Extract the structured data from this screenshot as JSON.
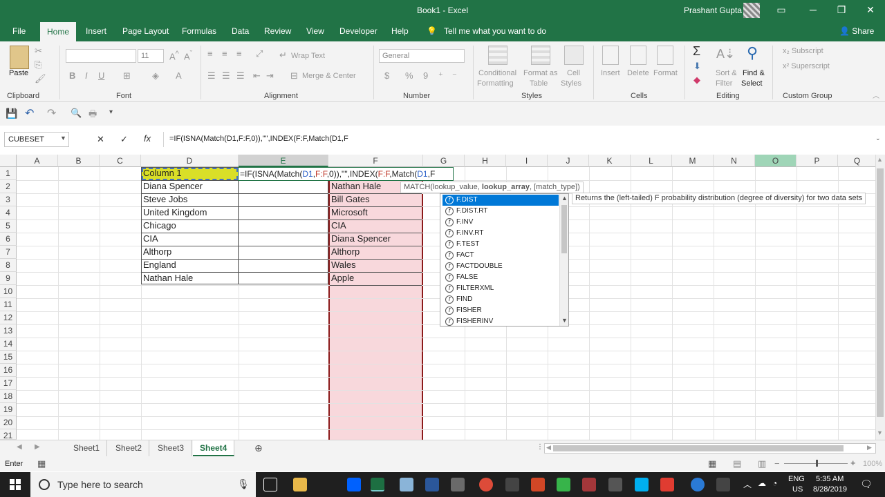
{
  "window": {
    "title": "Book1  -  Excel",
    "user": "Prashant Gupta"
  },
  "tabs": [
    "File",
    "Home",
    "Insert",
    "Page Layout",
    "Formulas",
    "Data",
    "Review",
    "View",
    "Developer",
    "Help"
  ],
  "tell_me": "Tell me what you want to do",
  "share": "Share",
  "ribbon": {
    "clipboard": {
      "label": "Clipboard",
      "paste": "Paste"
    },
    "font": {
      "label": "Font",
      "size": "11"
    },
    "alignment": {
      "label": "Alignment",
      "wrap": "Wrap Text",
      "merge": "Merge & Center"
    },
    "number": {
      "label": "Number",
      "format": "General"
    },
    "styles": {
      "label": "Styles",
      "cond1": "Conditional",
      "cond2": "Formatting",
      "fmt1": "Format as",
      "fmt2": "Table",
      "cell1": "Cell",
      "cell2": "Styles"
    },
    "cells": {
      "label": "Cells",
      "insert": "Insert",
      "delete": "Delete",
      "format": "Format"
    },
    "editing": {
      "label": "Editing",
      "sort1": "Sort &",
      "sort2": "Filter",
      "find1": "Find &",
      "find2": "Select"
    },
    "custom": {
      "label": "Custom Group",
      "subscript": "Subscript",
      "superscript": "Superscript"
    }
  },
  "namebox": "CUBESET",
  "formula": "=IF(ISNA(Match(D1,F:F,0)),\"\",INDEX(F:F,Match(D1,F",
  "columns": [
    "A",
    "B",
    "C",
    "D",
    "E",
    "F",
    "G",
    "H",
    "I",
    "J",
    "K",
    "L",
    "M",
    "N",
    "O",
    "P",
    "Q"
  ],
  "rows": [
    "1",
    "2",
    "3",
    "4",
    "5",
    "6",
    "7",
    "8",
    "9",
    "10",
    "11",
    "12",
    "13",
    "14",
    "15",
    "16",
    "17",
    "18",
    "19",
    "20",
    "21"
  ],
  "colD": [
    "Column 1",
    "Diana Spencer",
    "Steve Jobs",
    "United Kingdom",
    "Chicago",
    "CIA",
    "Althorp",
    "England",
    "Nathan Hale"
  ],
  "colF": [
    "Nathan Hale",
    "Bill Gates",
    "Microsoft",
    "CIA",
    "Diana Spencer",
    "Althorp",
    "Wales",
    "Apple"
  ],
  "e1_formula": {
    "p1": "=IF(ISNA(Match(",
    "p2": "D1",
    "p3": ",",
    "p4": "F:F",
    "p5": ",0)),\"\",INDEX(",
    "p6": "F:F",
    "p7": ",Match(",
    "p8": "D1",
    "p9": ",F"
  },
  "match_tip": {
    "a": "MATCH(lookup_value, ",
    "b": "lookup_array",
    "c": ", [match_type])"
  },
  "autocomplete": [
    "F.DIST",
    "F.DIST.RT",
    "F.INV",
    "F.INV.RT",
    "F.TEST",
    "FACT",
    "FACTDOUBLE",
    "FALSE",
    "FILTERXML",
    "FIND",
    "FISHER",
    "FISHERINV"
  ],
  "description": "Returns the (left-tailed) F probability distribution (degree of diversity) for two data sets",
  "sheets": [
    "Sheet1",
    "Sheet2",
    "Sheet3",
    "Sheet4"
  ],
  "status": {
    "mode": "Enter",
    "zoom": "100%"
  },
  "taskbar": {
    "search": "Type here to search",
    "lang1": "ENG",
    "lang2": "US",
    "time": "5:35 AM",
    "date": "8/28/2019"
  }
}
